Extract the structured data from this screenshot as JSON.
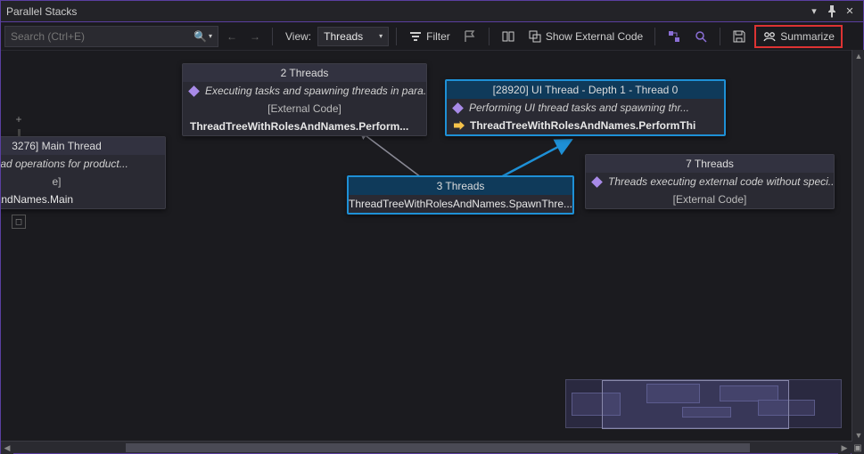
{
  "window": {
    "title": "Parallel Stacks"
  },
  "toolbar": {
    "search_placeholder": "Search (Ctrl+E)",
    "view_label": "View:",
    "view_value": "Threads",
    "filter_label": "Filter",
    "show_external_label": "Show External Code",
    "summarize_label": "Summarize"
  },
  "nodes": {
    "main": {
      "header": "3276] Main Thread",
      "desc": "in thread operations for product...",
      "ext": "e]",
      "frame": "ithRolesAndNames.Main"
    },
    "two": {
      "header": "2 Threads",
      "desc": "Executing tasks and spawning threads in para...",
      "ext": "[External Code]",
      "frame": "ThreadTreeWithRolesAndNames.Perform..."
    },
    "three": {
      "header": "3 Threads",
      "frame": "ThreadTreeWithRolesAndNames.SpawnThre..."
    },
    "ui": {
      "header": "[28920] UI Thread - Depth 1 - Thread 0",
      "desc": "Performing UI thread tasks and spawning thr...",
      "frame": "ThreadTreeWithRolesAndNames.PerformThi"
    },
    "seven": {
      "header": "7 Threads",
      "desc": "Threads executing external code without speci...",
      "ext": "[External Code]"
    }
  }
}
